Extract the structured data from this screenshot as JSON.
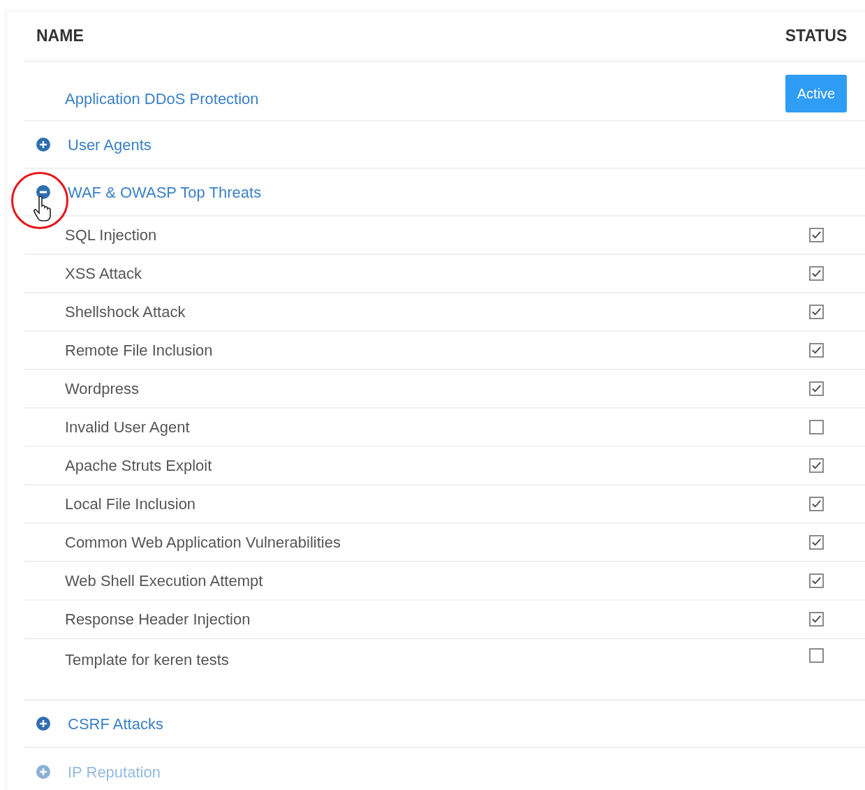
{
  "columns": [
    {
      "label": "NAME"
    },
    {
      "label": "STATUS"
    }
  ],
  "rows": [
    {
      "kind": "item",
      "name": "Application DDoS Protection",
      "status": "Active"
    },
    {
      "kind": "group",
      "name": "User Agents",
      "expanded": false,
      "faded": false
    },
    {
      "kind": "group",
      "name": "WAF & OWASP Top Threats",
      "expanded": true,
      "faded": false,
      "highlighted": true,
      "children": [
        {
          "name": "SQL Injection",
          "checked": true
        },
        {
          "name": "XSS Attack",
          "checked": true
        },
        {
          "name": "Shellshock Attack",
          "checked": true
        },
        {
          "name": "Remote File Inclusion",
          "checked": true
        },
        {
          "name": "Wordpress",
          "checked": true
        },
        {
          "name": "Invalid User Agent",
          "checked": false
        },
        {
          "name": "Apache Struts Exploit",
          "checked": true
        },
        {
          "name": "Local File Inclusion",
          "checked": true
        },
        {
          "name": "Common Web Application Vulnerabilities",
          "checked": true
        },
        {
          "name": "Web Shell Execution Attempt",
          "checked": true
        },
        {
          "name": "Response Header Injection",
          "checked": true
        },
        {
          "name": "Template for keren tests",
          "checked": false
        }
      ]
    },
    {
      "kind": "group",
      "name": "CSRF Attacks",
      "expanded": false,
      "faded": false
    },
    {
      "kind": "group",
      "name": "IP Reputation",
      "expanded": false,
      "faded": true
    }
  ]
}
